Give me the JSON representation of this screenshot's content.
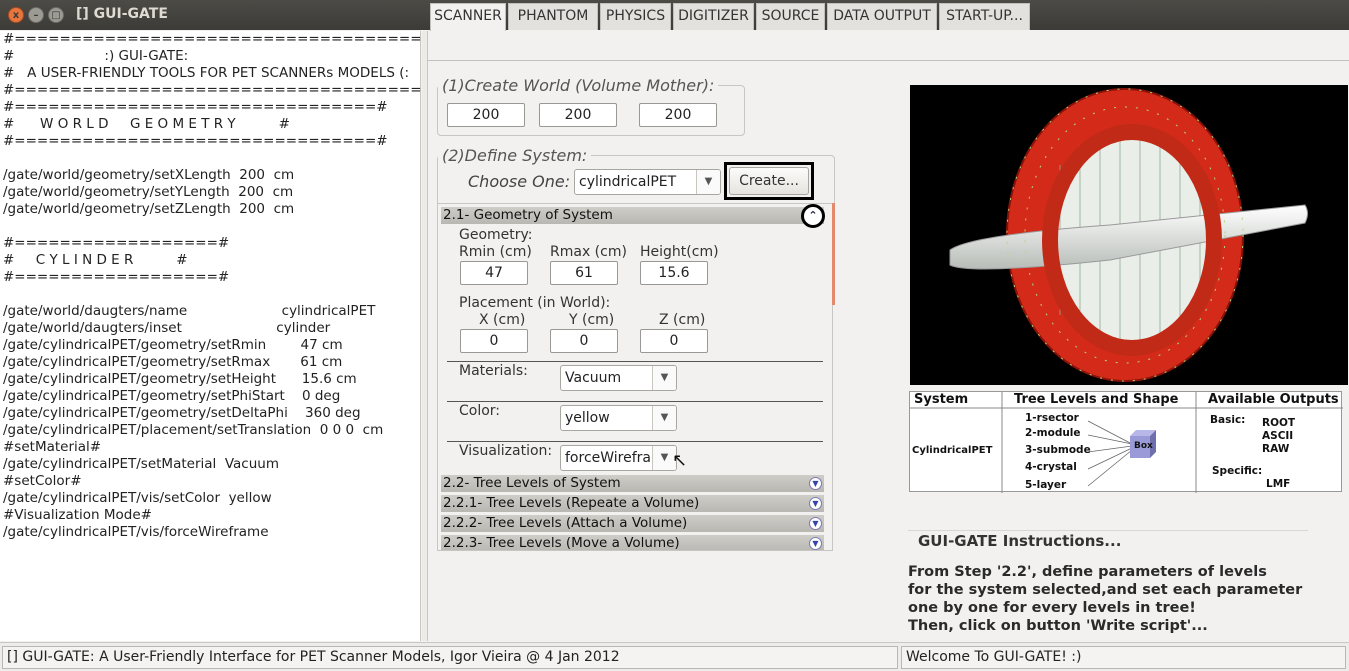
{
  "window": {
    "title": "[] GUI-GATE",
    "close": "x",
    "min": "–",
    "max": "□"
  },
  "tabs": [
    {
      "label": "SCANNER",
      "active": true
    },
    {
      "label": "PHANTOM"
    },
    {
      "label": "PHYSICS"
    },
    {
      "label": "DIGITIZER"
    },
    {
      "label": "SOURCE"
    },
    {
      "label": "DATA OUTPUT"
    },
    {
      "label": "START-UP..."
    }
  ],
  "script_lines": [
    "#===============================================#",
    "#                     :) GUI-GATE:",
    "#   A USER-FRIENDLY TOOLS FOR PET SCANNERs MODELS (:",
    "#===============================================#",
    "#================================#",
    "#      W O R L D     G E O M E T R Y          #",
    "#================================#",
    "",
    "/gate/world/geometry/setXLength  200  cm",
    "/gate/world/geometry/setYLength  200  cm",
    "/gate/world/geometry/setZLength  200  cm",
    "",
    "#==================#",
    "#     C Y L I N D E R          #",
    "#==================#",
    "",
    "/gate/world/daugters/name                      cylindricalPET",
    "/gate/world/daugters/inset                      cylinder",
    "/gate/cylindricalPET/geometry/setRmin        47 cm",
    "/gate/cylindricalPET/geometry/setRmax       61 cm",
    "/gate/cylindricalPET/geometry/setHeight      15.6 cm",
    "/gate/cylindricalPET/geometry/setPhiStart    0 deg",
    "/gate/cylindricalPET/geometry/setDeltaPhi    360 deg",
    "/gate/cylindricalPET/placement/setTranslation  0 0 0  cm",
    "#setMaterial#",
    "/gate/cylindricalPET/setMaterial  Vacuum",
    "#setColor#",
    "/gate/cylindricalPET/vis/setColor  yellow",
    "#Visualization Mode#",
    "/gate/cylindricalPET/vis/forceWireframe"
  ],
  "world": {
    "legend": "(1)Create World (Volume Mother):",
    "x": "200",
    "y": "200",
    "z": "200"
  },
  "system": {
    "legend": "(2)Define System:",
    "choose_label": "Choose One:",
    "selected": "cylindricalPET",
    "create_label": "Create..."
  },
  "geometry_panel": {
    "header": "2.1- Geometry of System",
    "geometry_label": "Geometry:",
    "rmin_label": "Rmin (cm)",
    "rmin": "47",
    "rmax_label": "Rmax (cm)",
    "rmax": "61",
    "height_label": "Height(cm)",
    "height": "15.6",
    "placement_label": "Placement (in World):",
    "px_label": "X (cm)",
    "px": "0",
    "py_label": "Y (cm)",
    "py": "0",
    "pz_label": "Z (cm)",
    "pz": "0",
    "materials_label": "Materials:",
    "material": "Vacuum",
    "color_label": "Color:",
    "color": "yellow",
    "vis_label": "Visualization:",
    "vis": "forceWirefra"
  },
  "sections": [
    "2.2- Tree Levels of System",
    "2.2.1- Tree Levels (Repeate a Volume)",
    "2.2.2- Tree Levels (Attach a Volume)",
    "2.2.3- Tree Levels (Move a Volume)"
  ],
  "tree_table": {
    "h_system": "System",
    "h_tree": "Tree Levels and Shape",
    "h_outputs": "Available Outputs",
    "system_name": "CylindricalPET",
    "levels": [
      "1-rsector",
      "2-module",
      "3-submode",
      "4-crystal",
      "5-layer"
    ],
    "box_label": "Box",
    "basic_label": "Basic:",
    "basic_outputs": [
      "ROOT",
      "ASCII",
      "RAW"
    ],
    "specific_label": "Specific:",
    "specific_outputs": [
      "LMF"
    ]
  },
  "instructions": {
    "title": "GUI-GATE Instructions...",
    "text": "From Step '2.2', define parameters of levels\nfor the system selected,and set each parameter\none by one for every levels in tree!\nThen, click on button 'Write script'..."
  },
  "status": {
    "left": "[] GUI-GATE: A User-Friendly Interface for PET Scanner Models, Igor Vieira @ 4 Jan 2012",
    "right": "Welcome To GUI-GATE! :)"
  },
  "colors": {
    "accent_close": "#e7753d",
    "ring": "#d42a1a",
    "scrollbar": "#e28a6b"
  }
}
